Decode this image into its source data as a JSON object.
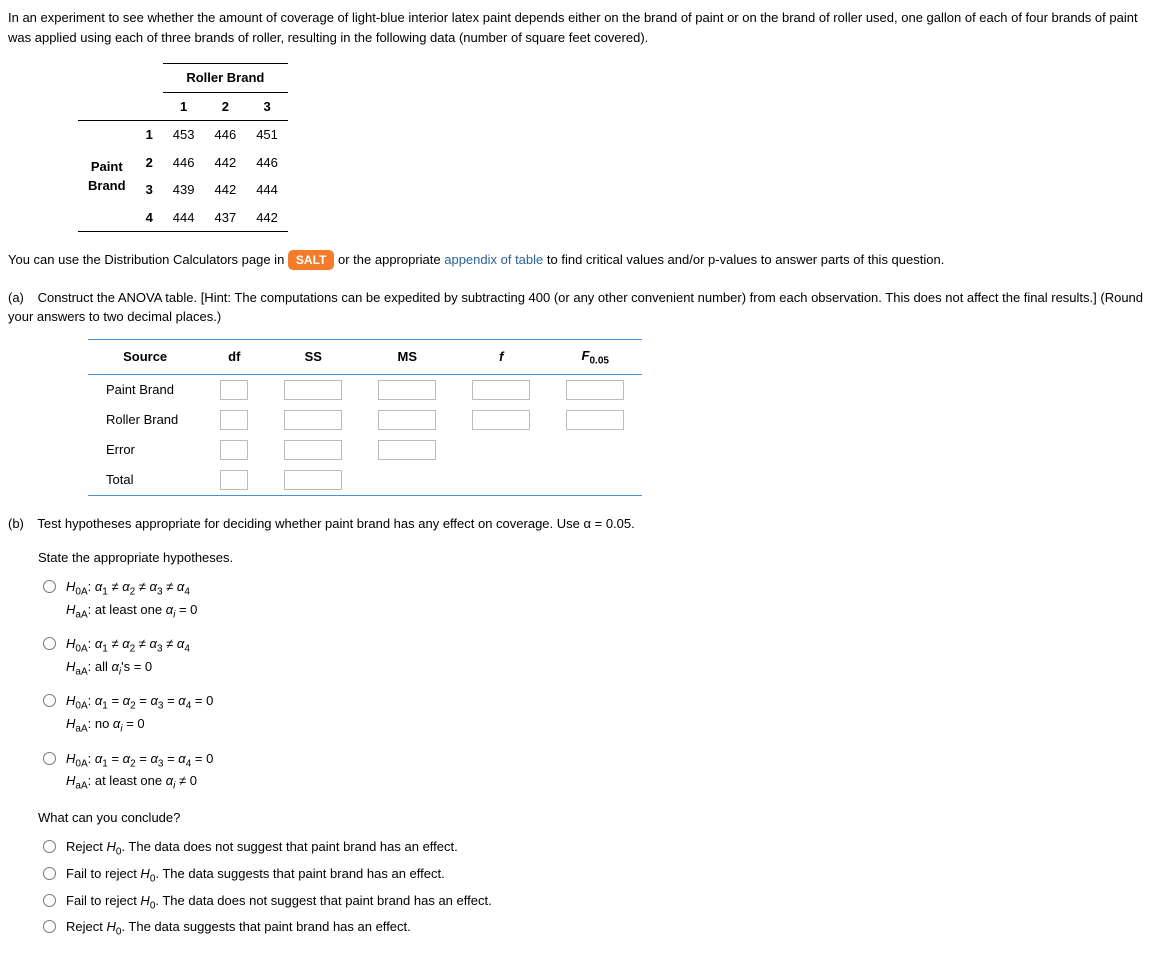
{
  "intro": "In an experiment to see whether the amount of coverage of light-blue interior latex paint depends either on the brand of paint or on the brand of roller used, one gallon of each of four brands of paint was applied using each of three brands of roller, resulting in the following data (number of square feet covered).",
  "dataTable": {
    "topHeader": "Roller Brand",
    "sideHeader": "Paint Brand",
    "cols": [
      "1",
      "2",
      "3"
    ],
    "rows": [
      "1",
      "2",
      "3",
      "4"
    ],
    "cells": [
      [
        "453",
        "446",
        "451"
      ],
      [
        "446",
        "442",
        "446"
      ],
      [
        "439",
        "442",
        "444"
      ],
      [
        "444",
        "437",
        "442"
      ]
    ]
  },
  "calcLine": {
    "p1": "You can use the Distribution Calculators page in ",
    "salt": "SALT",
    "p2": " or the appropriate ",
    "link": "appendix of table",
    "p3": " to find critical values and/or p-values to answer parts of this question."
  },
  "partA": {
    "label": "(a)",
    "text": "Construct the ANOVA table. [Hint: The computations can be expedited by subtracting 400 (or any other convenient number) from each observation. This does not affect the final results.] (Round your answers to two decimal places.)"
  },
  "anova": {
    "headers": [
      "Source",
      "df",
      "SS",
      "MS",
      "f",
      "F"
    ],
    "fSub": "0.05",
    "sources": [
      "Paint Brand",
      "Roller Brand",
      "Error",
      "Total"
    ]
  },
  "partB": {
    "label": "(b)",
    "text": "Test hypotheses appropriate for deciding whether paint brand has any effect on coverage. Use α = 0.05.",
    "stateH": "State the appropriate hypotheses.",
    "opts": [
      {
        "h0": "H0A: α1 ≠ α2 ≠ α3 ≠ α4",
        "ha": "HaA: at least one αi = 0"
      },
      {
        "h0": "H0A: α1 ≠ α2 ≠ α3 ≠ α4",
        "ha": "HaA: all αi's = 0"
      },
      {
        "h0": "H0A: α1 = α2 = α3 = α4 = 0",
        "ha": "HaA: no αi = 0"
      },
      {
        "h0": "H0A: α1 = α2 = α3 = α4 = 0",
        "ha": "HaA: at least one αi ≠ 0"
      }
    ],
    "conclude": "What can you conclude?",
    "concOpts": [
      "Reject H0. The data does not suggest that paint brand has an effect.",
      "Fail to reject H0. The data suggests that paint brand has an effect.",
      "Fail to reject H0. The data does not suggest that paint brand has an effect.",
      "Reject H0. The data suggests that paint brand has an effect."
    ]
  }
}
